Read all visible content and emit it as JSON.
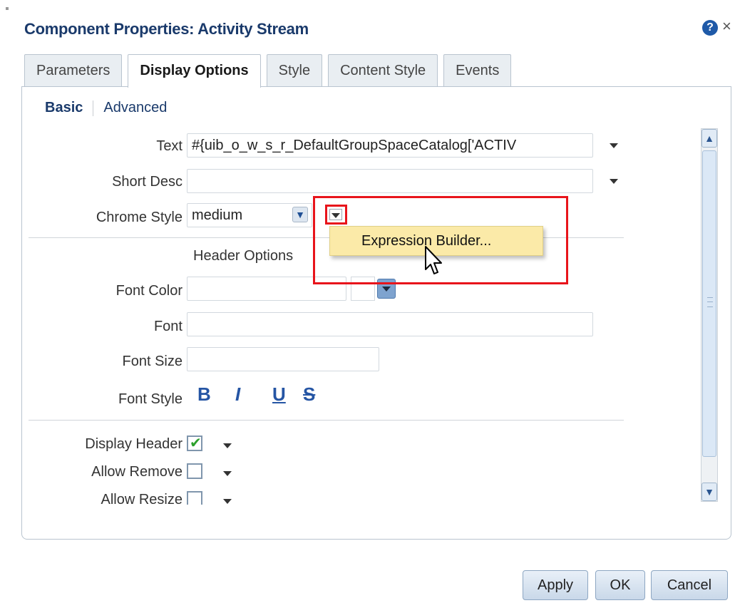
{
  "dialog": {
    "title": "Component Properties: Activity Stream",
    "help_icon": "?",
    "close_icon": "×"
  },
  "tabs": [
    {
      "label": "Parameters",
      "active": false
    },
    {
      "label": "Display Options",
      "active": true
    },
    {
      "label": "Style",
      "active": false
    },
    {
      "label": "Content Style",
      "active": false
    },
    {
      "label": "Events",
      "active": false
    }
  ],
  "subtabs": {
    "basic": "Basic",
    "advanced": "Advanced"
  },
  "fields": {
    "text_label": "Text",
    "text_value": "#{uib_o_w_s_r_DefaultGroupSpaceCatalog['ACTIV",
    "short_desc_label": "Short Desc",
    "short_desc_value": "",
    "chrome_style_label": "Chrome Style",
    "chrome_style_value": "medium",
    "header_options_label": "Header Options",
    "font_color_label": "Font Color",
    "font_color_value": "",
    "font_label": "Font",
    "font_value": "",
    "font_size_label": "Font Size",
    "font_size_value": "",
    "font_style_label": "Font Style",
    "font_style_buttons": {
      "bold": "B",
      "italic": "I",
      "underline": "U",
      "strike": "S"
    },
    "display_header_label": "Display Header",
    "display_header_checked": true,
    "allow_remove_label": "Allow Remove",
    "allow_remove_checked": false,
    "allow_resize_label": "Allow Resize",
    "allow_resize_checked": false
  },
  "popup_menu": {
    "item": "Expression Builder..."
  },
  "footer": {
    "apply": "Apply",
    "ok": "OK",
    "cancel": "Cancel"
  },
  "colors": {
    "highlight": "#e8141b",
    "popup_bg": "#fbeaa8",
    "link": "#1a3a6b"
  },
  "icons": [
    "help-icon",
    "close-icon",
    "chevron-down-icon",
    "scroll-up-icon",
    "scroll-down-icon",
    "pointer-cursor-icon"
  ]
}
